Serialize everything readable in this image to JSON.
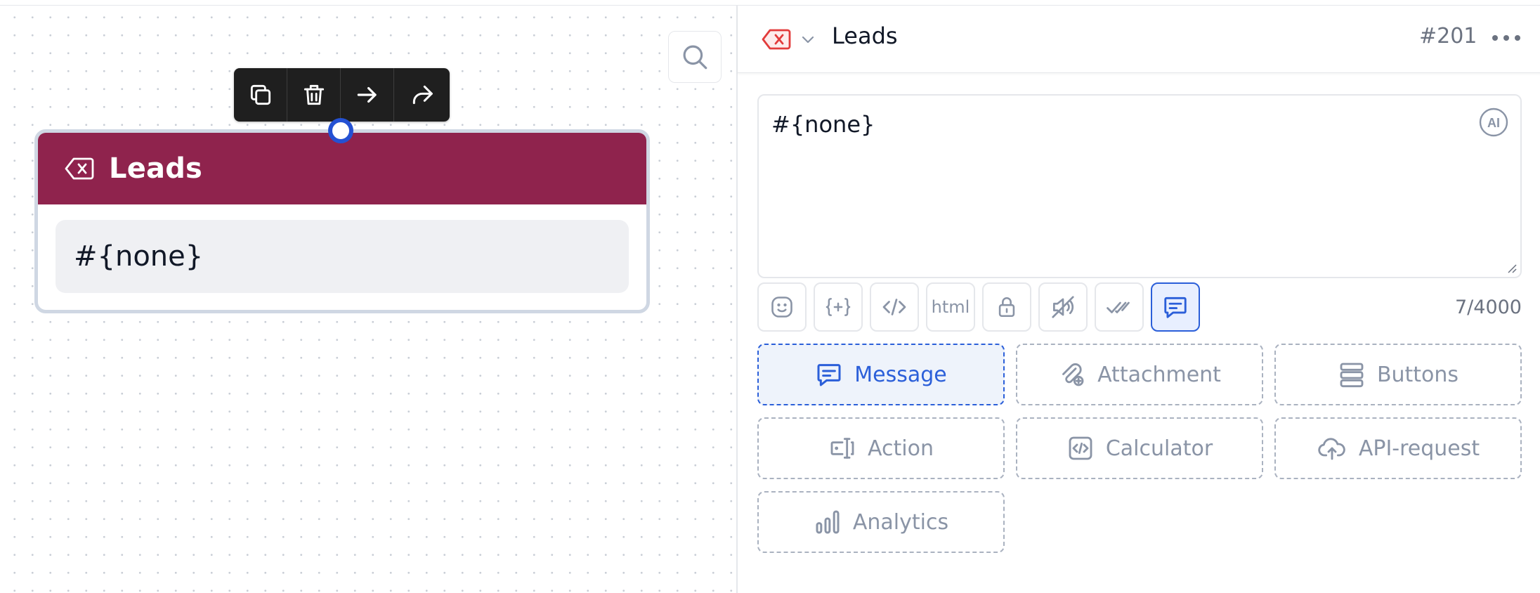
{
  "canvas": {
    "node": {
      "title": "Leads",
      "body": "#{none}"
    },
    "toolbar": [
      "copy-icon",
      "trash-icon",
      "arrow-right-icon",
      "share-icon"
    ]
  },
  "panel": {
    "header": {
      "title": "Leads",
      "id": "#201"
    },
    "editor": {
      "text": "#{none}",
      "ai_badge": "AI"
    },
    "format_buttons": [
      "emoji",
      "variable",
      "code",
      "html",
      "lock",
      "mute",
      "read",
      "message"
    ],
    "format_html_label": "html",
    "counter": "7/4000",
    "blocks": {
      "message": "Message",
      "attachment": "Attachment",
      "buttons": "Buttons",
      "action": "Action",
      "calculator": "Calculator",
      "api_request": "API-request",
      "analytics": "Analytics"
    }
  },
  "colors": {
    "node_header": "#8f234d",
    "accent": "#2b5fd9",
    "delete_red": "#e23b3b"
  }
}
